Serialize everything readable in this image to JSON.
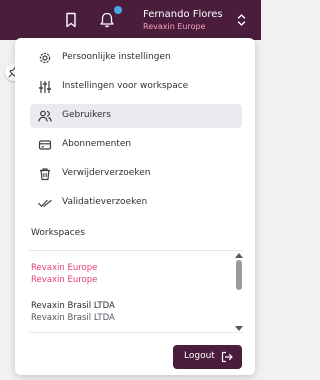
{
  "header": {
    "user_name": "Fernando Flores",
    "organization": "Revaxin Europe",
    "notification_dot_color": "#4aa8e8",
    "bookmark_icon": "bookmark-icon",
    "bell_icon": "bell-icon",
    "expand_icon": "chevron-up-down-icon"
  },
  "pin_icon": "pin-icon",
  "menu": {
    "items": [
      {
        "label": "Persoonlijke instellingen",
        "icon": "gear-icon",
        "active": false
      },
      {
        "label": "Instellingen voor workspace",
        "icon": "sliders-icon",
        "active": false
      },
      {
        "label": "Gebruikers",
        "icon": "users-icon",
        "active": true
      },
      {
        "label": "Abonnementen",
        "icon": "credit-card-icon",
        "active": false
      },
      {
        "label": "Verwijderverzoeken",
        "icon": "trash-icon",
        "active": false
      },
      {
        "label": "Validatieverzoeken",
        "icon": "double-check-icon",
        "active": false
      }
    ]
  },
  "workspaces": {
    "title": "Workspaces",
    "items": [
      {
        "name": "Revaxin Europe",
        "subtitle": "Revaxin Europe",
        "selected": true
      },
      {
        "name": "Revaxin Brasil LTDA",
        "subtitle": "Revaxin Brasil LTDA",
        "selected": false
      }
    ]
  },
  "logout": {
    "label": "Logout",
    "icon": "logout-icon"
  },
  "colors": {
    "brand": "#4a1d3c",
    "accent": "#e63d78",
    "active_bg": "#e9e9ee",
    "org_text": "#f6a0bb"
  }
}
